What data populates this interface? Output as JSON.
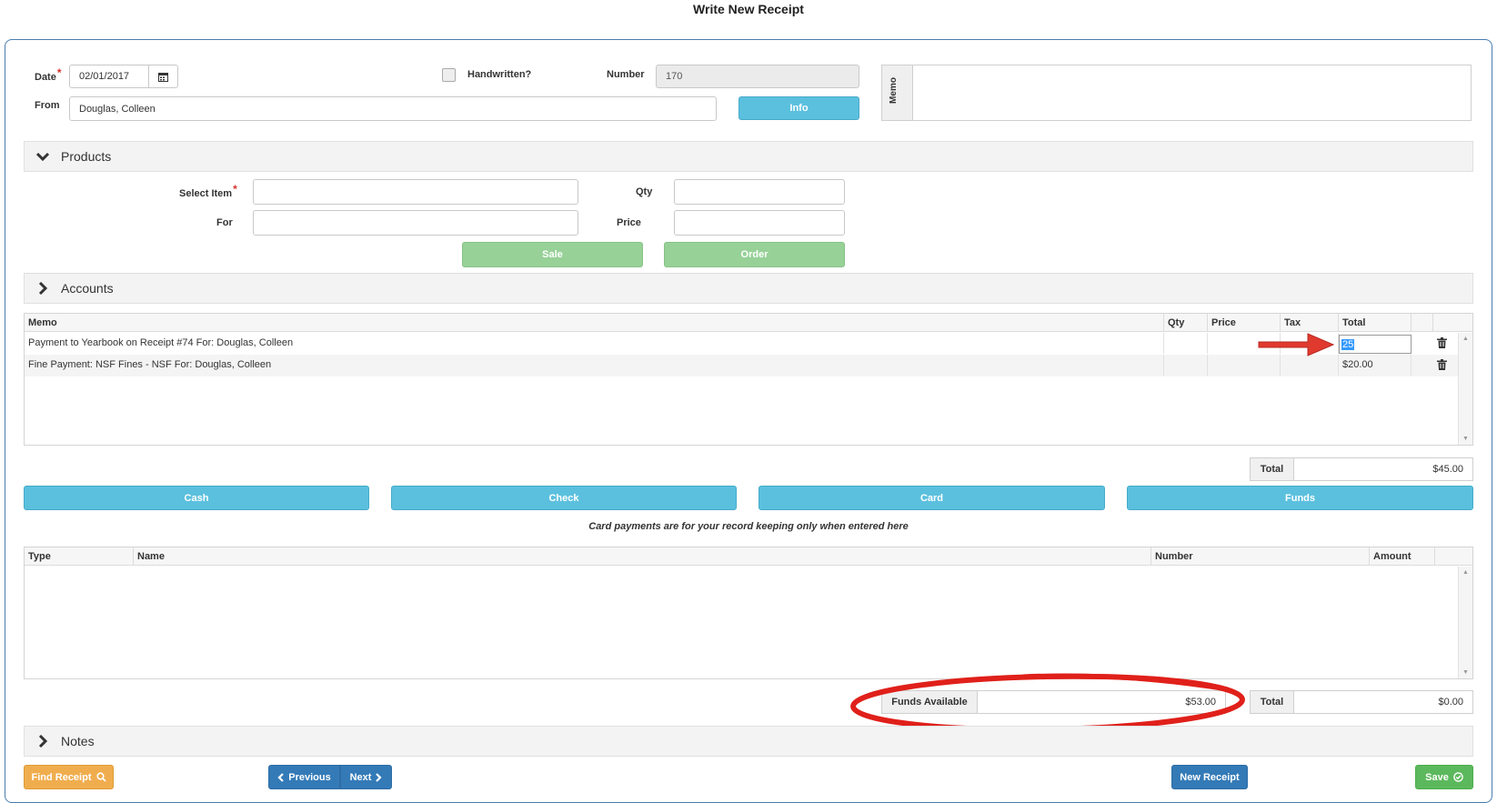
{
  "page": {
    "title": "Write New Receipt"
  },
  "header": {
    "date_label": "Date",
    "date_value": "02/01/2017",
    "handwritten_label": "Handwritten?",
    "number_label": "Number",
    "number_value": "170",
    "from_label": "From",
    "from_value": "Douglas, Colleen",
    "info_label": "Info",
    "memo_label": "Memo",
    "memo_value": ""
  },
  "products": {
    "title": "Products",
    "select_item_label": "Select Item",
    "qty_label": "Qty",
    "for_label": "For",
    "price_label": "Price",
    "sale_label": "Sale",
    "order_label": "Order"
  },
  "accounts": {
    "title": "Accounts",
    "columns": [
      "Memo",
      "Qty",
      "Price",
      "Tax",
      "Total"
    ],
    "rows": [
      {
        "memo": "Payment to Yearbook on Receipt #74 For: Douglas, Colleen",
        "qty": "",
        "price": "",
        "tax": "",
        "total": "25"
      },
      {
        "memo": "Fine Payment: NSF Fines - NSF For: Douglas, Colleen",
        "qty": "",
        "price": "",
        "tax": "",
        "total": "$20.00"
      }
    ],
    "total_label": "Total",
    "total_value": "$45.00"
  },
  "payment_buttons": {
    "cash": "Cash",
    "check": "Check",
    "card": "Card",
    "funds": "Funds"
  },
  "card_note": "Card payments are for your record keeping only when entered here",
  "payments": {
    "columns": [
      "Type",
      "Name",
      "Number",
      "Amount"
    ],
    "funds_available_label": "Funds Available",
    "funds_available_value": "$53.00",
    "total_label": "Total",
    "total_value": "$0.00"
  },
  "notes": {
    "title": "Notes"
  },
  "footer": {
    "find_receipt": "Find Receipt",
    "previous": "Previous",
    "next": "Next",
    "new_receipt": "New Receipt",
    "save": "Save"
  },
  "annotations": {
    "arrow_color": "#e03a2f",
    "circle_color": "#e0201a"
  },
  "icons": [
    "calendar-icon",
    "chevron-down-icon",
    "chevron-right-icon",
    "trash-icon",
    "search-icon",
    "check-circle-icon"
  ]
}
